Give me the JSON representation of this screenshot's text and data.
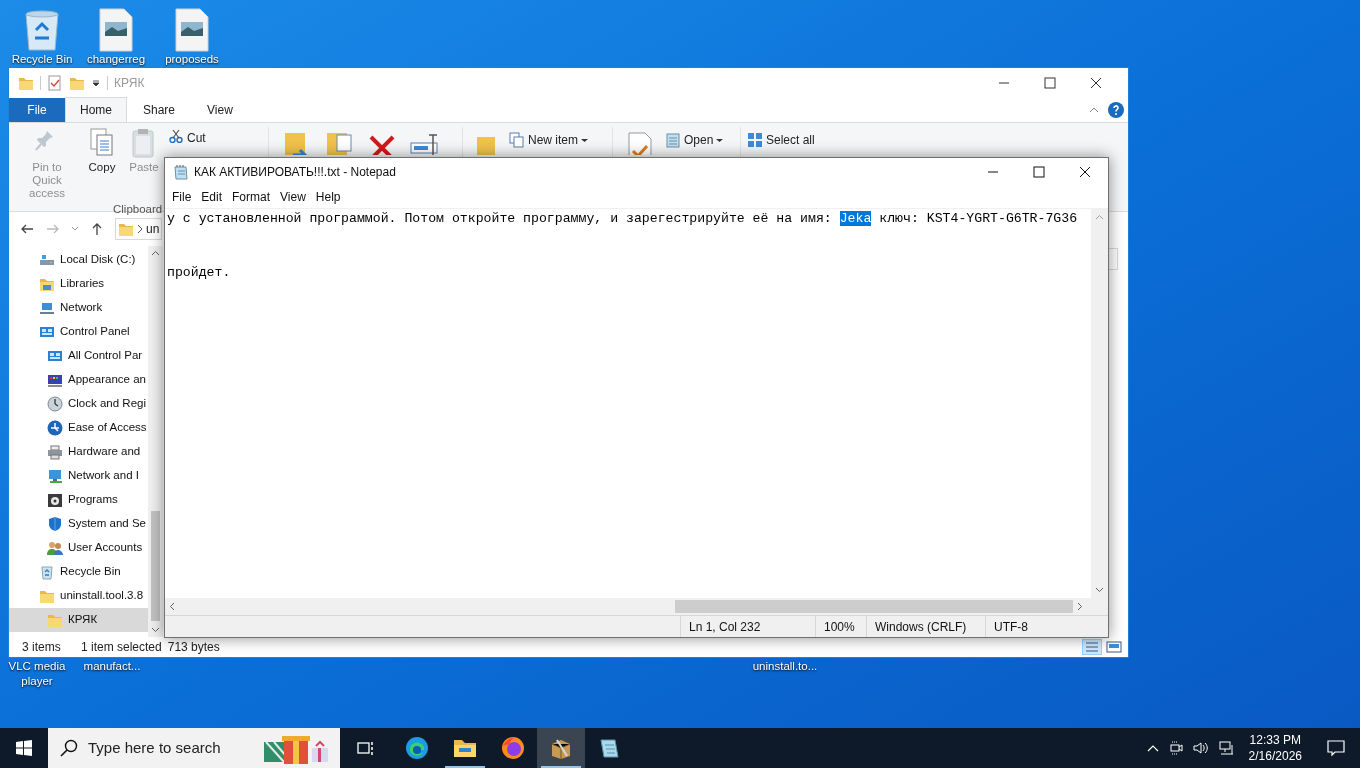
{
  "desktop_icons": [
    {
      "label": "Recycle Bin",
      "kind": "recycle"
    },
    {
      "label": "changerreg",
      "kind": "image"
    },
    {
      "label": "proposeds",
      "kind": "image"
    }
  ],
  "desktop_labels_below": [
    "VLC media player",
    "manufact...",
    "uninstall.to..."
  ],
  "explorer": {
    "title": "КРЯК",
    "tabs": [
      {
        "label": "File",
        "kind": "file",
        "selected": false
      },
      {
        "label": "Home",
        "kind": "tab",
        "selected": true
      },
      {
        "label": "Share",
        "kind": "tab",
        "selected": false
      },
      {
        "label": "View",
        "kind": "tab",
        "selected": false
      }
    ],
    "ribbon": {
      "large_buttons": [
        {
          "label": "Pin to Quick access",
          "kind": "pin",
          "disabled": true
        },
        {
          "label": "Copy",
          "kind": "copy",
          "disabled": false
        },
        {
          "label": "Paste",
          "kind": "paste",
          "disabled": true
        }
      ],
      "cut": "Cut",
      "group_label": "Clipboard",
      "new_item": "New item",
      "open": "Open",
      "select_all": "Select all"
    },
    "address_path": "un",
    "nav": [
      {
        "label": "Local Disk (C:)",
        "kind": "disk",
        "selected": false
      },
      {
        "label": "Libraries",
        "kind": "libraries",
        "selected": false
      },
      {
        "label": "Network",
        "kind": "network",
        "selected": false
      },
      {
        "label": "Control Panel",
        "kind": "panel",
        "selected": false,
        "children": [
          {
            "label": "All Control Par",
            "kind": "panel",
            "selected": false
          },
          {
            "label": "Appearance an",
            "kind": "appearance",
            "selected": false
          },
          {
            "label": "Clock and Regi",
            "kind": "clock",
            "selected": false
          },
          {
            "label": "Ease of Access",
            "kind": "ease",
            "selected": false
          },
          {
            "label": "Hardware and",
            "kind": "hardware",
            "selected": false
          },
          {
            "label": "Network and I",
            "kind": "netcenter",
            "selected": false
          },
          {
            "label": "Programs",
            "kind": "programs",
            "selected": false
          },
          {
            "label": "System and Se",
            "kind": "system",
            "selected": false
          },
          {
            "label": "User Accounts",
            "kind": "users",
            "selected": false
          }
        ]
      },
      {
        "label": "Recycle Bin",
        "kind": "recycle",
        "selected": false
      },
      {
        "label": "uninstall.tool.3.8",
        "kind": "folder",
        "selected": false,
        "children": [
          {
            "label": "КРЯК",
            "kind": "folder",
            "selected": true
          }
        ]
      }
    ],
    "status": {
      "count": "3 items",
      "selection": "1 item selected",
      "size": "713 bytes"
    }
  },
  "notepad": {
    "title": "КАК АКТИВИРОВАТЬ!!!.txt - Notepad",
    "menu": [
      "File",
      "Edit",
      "Format",
      "View",
      "Help"
    ],
    "lines": [
      {
        "segments": [
          {
            "text": "у с установленной программой. Потом откройте программу, и зарегестрируйте её на имя: ",
            "selected": false
          },
          {
            "text": "Jeka",
            "selected": true
          },
          {
            "text": " ключ: KST4-YGRT-G6TR-7G36",
            "selected": false
          }
        ]
      },
      {
        "segments": [
          {
            "text": "пройдет.",
            "selected": false
          }
        ]
      }
    ],
    "status": {
      "position": "Ln 1, Col 232",
      "zoom": "100%",
      "line_ending": "Windows (CRLF)",
      "encoding": "UTF-8"
    }
  },
  "taskbar": {
    "search_placeholder": "Type here to search",
    "apps": [
      {
        "kind": "edge",
        "running": false,
        "selected": false
      },
      {
        "kind": "explorer",
        "running": true,
        "selected": false
      },
      {
        "kind": "firefox",
        "running": false,
        "selected": false
      },
      {
        "kind": "archive",
        "running": true,
        "selected": true
      },
      {
        "kind": "notepad",
        "running": false,
        "selected": false
      }
    ],
    "time": "12:33 PM",
    "date": "2/16/2026"
  }
}
